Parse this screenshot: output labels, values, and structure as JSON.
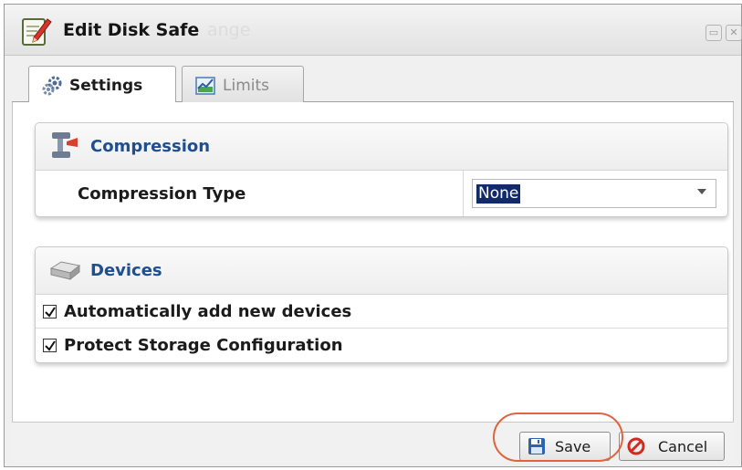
{
  "window": {
    "title": "Edit Disk Safe",
    "title_ghost": "ange"
  },
  "tabs": [
    {
      "label": "Settings",
      "icon": "gears-icon",
      "active": true
    },
    {
      "label": "Limits",
      "icon": "chart-icon",
      "active": false
    }
  ],
  "compression": {
    "section_title": "Compression",
    "field_label": "Compression Type",
    "selected_value": "None"
  },
  "devices": {
    "section_title": "Devices",
    "options": [
      {
        "label": "Automatically add new devices",
        "checked": true
      },
      {
        "label": "Protect Storage Configuration",
        "checked": true
      }
    ]
  },
  "footer": {
    "save_label": "Save",
    "cancel_label": "Cancel"
  },
  "colors": {
    "section_title": "#1f4f8f",
    "selection_bg": "#102a6c",
    "highlight_ring": "#e0643c"
  }
}
